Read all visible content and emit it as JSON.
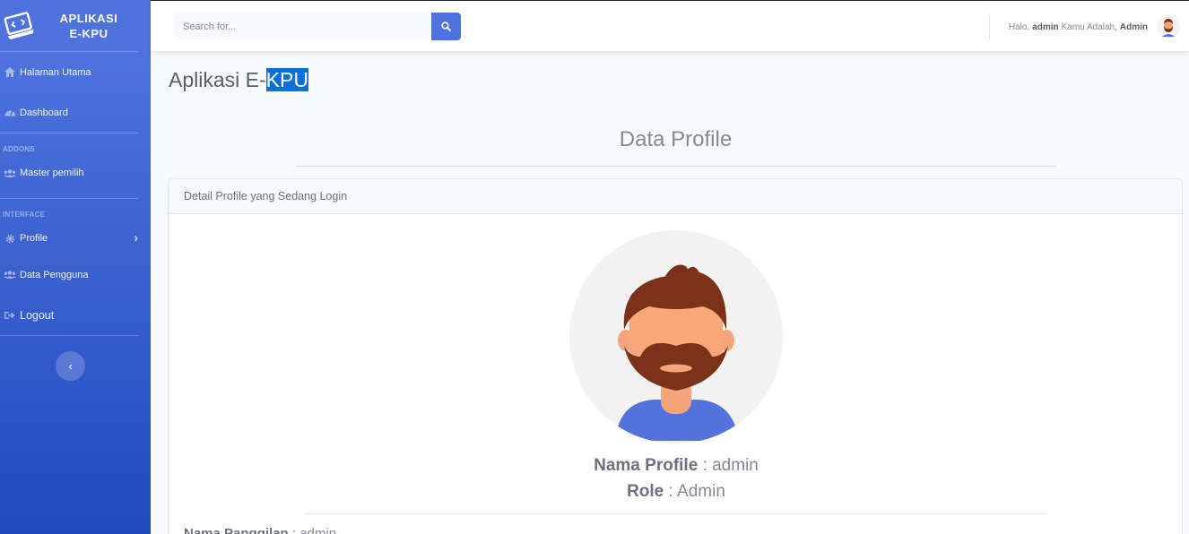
{
  "sidebar": {
    "brand_line1": "APLIKASI",
    "brand_line2": "E-KPU",
    "items": [
      {
        "label": "Halaman Utama",
        "icon": "home-icon"
      },
      {
        "label": "Dashboard",
        "icon": "dashboard-icon"
      }
    ],
    "heading_addons": "ADDONS",
    "addons": [
      {
        "label": "Master pemilih",
        "icon": "users-icon"
      }
    ],
    "heading_interface": "INTERFACE",
    "interface": [
      {
        "label": "Profile",
        "icon": "gear-icon"
      },
      {
        "label": "Data Pengguna",
        "icon": "users-icon"
      },
      {
        "label": "Logout",
        "icon": "logout-icon"
      }
    ],
    "toggle_glyph": "‹"
  },
  "topbar": {
    "search_placeholder": "Search for...",
    "greeting_prefix": "Halo,",
    "username": "admin",
    "role_prefix": "Kamu Adalah,",
    "role": "Admin"
  },
  "main": {
    "page_title_prefix": "Aplikasi E-",
    "page_title_selected": "KPU",
    "section_title": "Data Profile",
    "card_header": "Detail Profile yang Sedang Login",
    "nama_profile_label": "Nama Profile",
    "nama_profile_value": ": admin",
    "role_label": "Role",
    "role_value": ": Admin",
    "nama_panggilan_label": "Nama Panggilan",
    "nama_panggilan_value": ": admin"
  },
  "colors": {
    "sidebar_top": "#4e73df",
    "sidebar_bottom": "#224abe",
    "accent": "#4e73df",
    "selection": "#0a6fd8"
  }
}
